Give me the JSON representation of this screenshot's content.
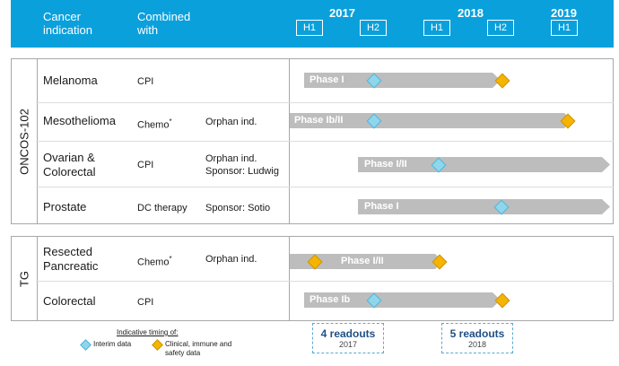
{
  "header": {
    "col_indication": "Cancer indication",
    "col_combined": "Combined with",
    "years": [
      "2017",
      "2018",
      "2019"
    ],
    "halves": [
      "H1",
      "H2",
      "H1",
      "H2",
      "H1"
    ]
  },
  "groups": [
    {
      "label": "ONCOS-102",
      "rows": [
        {
          "indication": "Melanoma",
          "combined": "CPI",
          "combined_mark": "",
          "note": "",
          "phase": "Phase I",
          "interim": "2017 H2",
          "clinical": "2018 H2"
        },
        {
          "indication": "Mesothelioma",
          "combined": "Chemo",
          "combined_mark": "*",
          "note": "Orphan ind.",
          "phase": "Phase Ib/II",
          "interim": "2017 H2",
          "clinical": "2019 H1"
        },
        {
          "indication": "Ovarian &\nColorectal",
          "combined": "CPI",
          "combined_mark": "",
          "note": "Orphan ind.\nSponsor: Ludwig",
          "phase": "Phase I/II",
          "interim": "2018 H1",
          "clinical": ""
        },
        {
          "indication": "Prostate",
          "combined": "DC therapy",
          "combined_mark": "",
          "note": "Sponsor: Sotio",
          "phase": "Phase I",
          "interim": "2018 H2",
          "clinical": ""
        }
      ]
    },
    {
      "label": "TG",
      "rows": [
        {
          "indication": "Resected\nPancreatic",
          "combined": "Chemo",
          "combined_mark": "*",
          "note": "Orphan ind.",
          "phase": "Phase I/II",
          "interim": "",
          "clinical": "2017 H1, 2018 H1"
        },
        {
          "indication": "Colorectal",
          "combined": "CPI",
          "combined_mark": "",
          "note": "",
          "phase": "Phase Ib",
          "interim": "2017 H2",
          "clinical": "2018 H2"
        }
      ]
    }
  ],
  "legend": {
    "title": "Indicative timing of:",
    "interim": "Interim data",
    "clinical": "Clinical, immune and\nsafety data",
    "interim_color": "#8fd6ec",
    "clinical_color": "#f5b400"
  },
  "readouts": [
    {
      "count": "4 readouts",
      "year": "2017"
    },
    {
      "count": "5 readouts",
      "year": "2018"
    }
  ],
  "colors": {
    "header": "#0aa0dc",
    "arrow": "#bdbdbd",
    "readout_text": "#1f4f86"
  }
}
